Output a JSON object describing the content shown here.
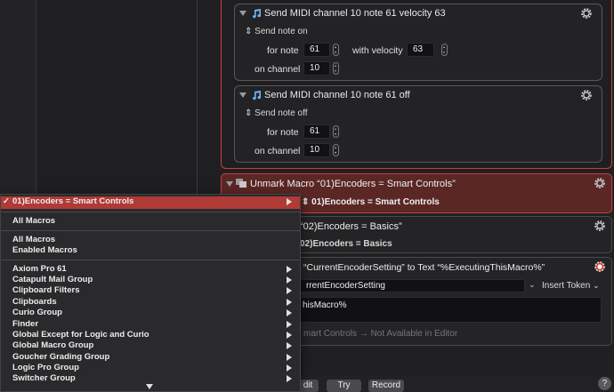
{
  "actions": {
    "send_on": {
      "title": "Send MIDI channel 10 note 61 velocity 63",
      "mode": "Send note on",
      "for_note_label": "for note",
      "note": "61",
      "with_velocity_label": "with velocity",
      "velocity": "63",
      "on_channel_label": "on channel",
      "channel": "10"
    },
    "send_off": {
      "title": "Send MIDI channel 10 note 61 off",
      "mode": "Send note off",
      "for_note_label": "for note",
      "note": "61",
      "on_channel_label": "on channel",
      "channel": "10"
    },
    "unmark": {
      "title": "Unmark Macro “01)Encoders = Smart Controls”",
      "value": "01)Encoders = Smart Controls"
    },
    "mark": {
      "title_fragment": "“02)Encoders = Basics”",
      "value_fragment": "02)Encoders = Basics"
    },
    "set_var": {
      "title_fragment": "“CurrentEncoderSetting” to Text “%ExecutingThisMacro%”",
      "variable_fragment": "rrentEncoderSetting",
      "insert_token": "Insert Token",
      "text_fragment": "hisMacro%",
      "preview_fragment": "mart Controls",
      "preview_arrow": "→",
      "preview_status": "Not Available in Editor"
    }
  },
  "bottom_bar": {
    "edit_fragment": "dit",
    "try": "Try",
    "record": "Record",
    "help": "?"
  },
  "menu": {
    "selected_check": "✓",
    "selected": "01)Encoders = Smart Controls",
    "items_a": [
      "All Macros"
    ],
    "items_b": [
      "All Macros",
      "Enabled Macros"
    ],
    "groups": [
      "Axiom Pro 61",
      "Catapult Mail Group",
      "Clipboard Filters",
      "Clipboards",
      "Curio Group",
      "Finder",
      "Global Except for Logic and Curio",
      "Global Macro Group",
      "Goucher Grading Group",
      "Logic Pro Group",
      "Switcher Group"
    ]
  },
  "colors": {
    "accent_red": "#c9413c",
    "menu_highlight": "#b03a36",
    "note_icon": "#6fb6ff"
  }
}
